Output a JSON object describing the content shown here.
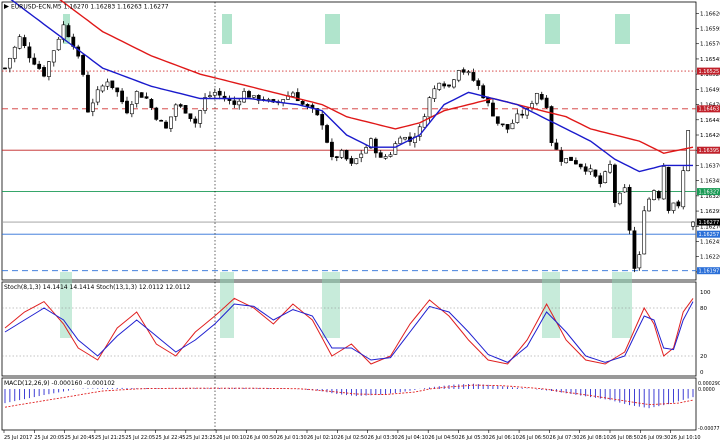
{
  "header": {
    "symbol_line": "EURUSD-ECN,M5  1.16270 1.16283 1.16263 1.16277"
  },
  "price_axis": {
    "ticks": [
      "1.16620",
      "1.16595",
      "1.16570",
      "1.16545",
      "1.16520",
      "1.16495",
      "1.16470",
      "1.16445",
      "1.16420",
      "1.16395",
      "1.16370",
      "1.16345",
      "1.16320",
      "1.16295",
      "1.16270",
      "1.16245",
      "1.16220",
      "1.16195"
    ],
    "range": [
      1.16185,
      1.16632
    ]
  },
  "price_tags": [
    {
      "id": "tag-1",
      "text": "1.16525",
      "price": 1.16525,
      "color": "#c0202a"
    },
    {
      "id": "tag-2",
      "text": "1.16463",
      "price": 1.16463,
      "color": "#c0202a"
    },
    {
      "id": "tag-3",
      "text": "1.16395",
      "price": 1.16395,
      "color": "#c0202a"
    },
    {
      "id": "tag-4",
      "text": "1.16327",
      "price": 1.16327,
      "color": "#1a9a55"
    },
    {
      "id": "tag-5",
      "text": "1.16277",
      "price": 1.16277,
      "color": "#000000"
    },
    {
      "id": "tag-6",
      "text": "1.16257",
      "price": 1.16257,
      "color": "#2a6fd8"
    },
    {
      "id": "tag-7",
      "text": "1.16197",
      "price": 1.16197,
      "color": "#2a6fd8"
    }
  ],
  "hlines": [
    {
      "price": 1.16525,
      "color": "#d03030",
      "style": "dotted"
    },
    {
      "price": 1.16463,
      "color": "#d03030",
      "style": "dashed"
    },
    {
      "price": 1.16395,
      "color": "#c02020",
      "style": "solid"
    },
    {
      "price": 1.16327,
      "color": "#1a9a55",
      "style": "solid"
    },
    {
      "price": 1.16277,
      "color": "#9a9a9a",
      "style": "solid"
    },
    {
      "price": 1.16257,
      "color": "#2a6fd8",
      "style": "solid"
    },
    {
      "price": 1.16197,
      "color": "#2a6fd8",
      "style": "dashed"
    }
  ],
  "stoch": {
    "header": "Stoch(8,1,3) 14.1414 14.1414  Stoch(13,1,3) 12.0112 12.0112",
    "ticks": [
      "100",
      "80",
      "20",
      "0"
    ],
    "range": [
      0,
      100
    ]
  },
  "macd": {
    "header": "MACD(12,26,9) -0.000160 -0.000102",
    "ticks": [
      "0.000290",
      "0.0000",
      "-0.000773"
    ]
  },
  "time_axis": {
    "labels": [
      "25 Jul 2017",
      "25 Jul 20:05",
      "25 Jul 20:45",
      "25 Jul 21:25",
      "25 Jul 22:05",
      "25 Jul 22:45",
      "25 Jul 23:25",
      "26 Jul 00:10",
      "26 Jul 00:50",
      "26 Jul 01:30",
      "26 Jul 02:10",
      "26 Jul 02:50",
      "26 Jul 03:30",
      "26 Jul 04:10",
      "26 Jul 04:50",
      "26 Jul 05:30",
      "26 Jul 06:10",
      "26 Jul 06:50",
      "26 Jul 07:30",
      "26 Jul 08:10",
      "26 Jul 08:50",
      "26 Jul 09:30",
      "26 Jul 10:10"
    ]
  },
  "colors": {
    "bull": "#ffffff",
    "bear": "#000000",
    "ma_fast": "#1a1acc",
    "ma_slow": "#e01818",
    "stoch_main": "#e02020",
    "stoch_signal": "#2020d0",
    "macd_hist": "#2a2ad0",
    "macd_signal": "#e02020",
    "highlight": "#8fd8b6"
  },
  "chart_data": {
    "type": "candlestick",
    "symbol": "EURUSD-ECN",
    "timeframe": "M5",
    "ohlc_last": {
      "open": 1.1627,
      "high": 1.16283,
      "low": 1.16263,
      "close": 1.16277
    },
    "close_path": [
      [
        0,
        1.1653
      ],
      [
        3,
        1.1658
      ],
      [
        5,
        1.1655
      ],
      [
        8,
        1.1652
      ],
      [
        10,
        1.1656
      ],
      [
        12,
        1.166
      ],
      [
        14,
        1.1657
      ],
      [
        16,
        1.1652
      ],
      [
        17,
        1.1646
      ],
      [
        19,
        1.1649
      ],
      [
        21,
        1.1651
      ],
      [
        23,
        1.1649
      ],
      [
        25,
        1.1646
      ],
      [
        27,
        1.1649
      ],
      [
        29,
        1.1648
      ],
      [
        31,
        1.1645
      ],
      [
        33,
        1.1643
      ],
      [
        35,
        1.1647
      ],
      [
        37,
        1.1646
      ],
      [
        39,
        1.1644
      ],
      [
        41,
        1.1648
      ],
      [
        43,
        1.1649
      ],
      [
        45,
        1.1648
      ],
      [
        47,
        1.1647
      ],
      [
        49,
        1.1649
      ],
      [
        51,
        1.1648
      ],
      [
        53,
        1.1648
      ],
      [
        55,
        1.1647
      ],
      [
        57,
        1.1648
      ],
      [
        59,
        1.1649
      ],
      [
        61,
        1.1647
      ],
      [
        63,
        1.1646
      ],
      [
        65,
        1.1644
      ],
      [
        66,
        1.1641
      ],
      [
        67,
        1.1638
      ],
      [
        69,
        1.1639
      ],
      [
        71,
        1.1637
      ],
      [
        73,
        1.1639
      ],
      [
        75,
        1.1641
      ],
      [
        77,
        1.1638
      ],
      [
        79,
        1.1639
      ],
      [
        81,
        1.1642
      ],
      [
        83,
        1.1641
      ],
      [
        85,
        1.1643
      ],
      [
        87,
        1.1648
      ],
      [
        89,
        1.1651
      ],
      [
        91,
        1.165
      ],
      [
        93,
        1.1653
      ],
      [
        95,
        1.1652
      ],
      [
        97,
        1.165
      ],
      [
        99,
        1.1647
      ],
      [
        101,
        1.1644
      ],
      [
        103,
        1.1643
      ],
      [
        105,
        1.1645
      ],
      [
        107,
        1.1646
      ],
      [
        109,
        1.1649
      ],
      [
        111,
        1.1647
      ],
      [
        112,
        1.1641
      ],
      [
        114,
        1.1638
      ],
      [
        116,
        1.1638
      ],
      [
        118,
        1.1637
      ],
      [
        120,
        1.1636
      ],
      [
        122,
        1.1634
      ],
      [
        124,
        1.1637
      ],
      [
        125,
        1.1631
      ],
      [
        127,
        1.1633
      ],
      [
        129,
        1.162
      ],
      [
        130,
        1.1622
      ],
      [
        131,
        1.163
      ],
      [
        133,
        1.1633
      ],
      [
        134,
        1.1632
      ],
      [
        135,
        1.1637
      ],
      [
        136,
        1.163
      ],
      [
        137,
        1.1631
      ],
      [
        138,
        1.163
      ],
      [
        139,
        1.1636
      ],
      [
        140,
        1.1643
      ],
      [
        141,
        1.164
      ]
    ],
    "ma_fast": [
      [
        0,
        1.1665
      ],
      [
        10,
        1.1659
      ],
      [
        20,
        1.1653
      ],
      [
        30,
        1.165
      ],
      [
        40,
        1.1648
      ],
      [
        50,
        1.1648
      ],
      [
        60,
        1.1647
      ],
      [
        65,
        1.1646
      ],
      [
        70,
        1.1642
      ],
      [
        75,
        1.164
      ],
      [
        80,
        1.164
      ],
      [
        85,
        1.1642
      ],
      [
        90,
        1.1647
      ],
      [
        95,
        1.1649
      ],
      [
        100,
        1.1648
      ],
      [
        105,
        1.1647
      ],
      [
        110,
        1.1645
      ],
      [
        115,
        1.1643
      ],
      [
        120,
        1.1641
      ],
      [
        125,
        1.1638
      ],
      [
        130,
        1.1636
      ],
      [
        135,
        1.1637
      ],
      [
        141,
        1.1637
      ]
    ],
    "ma_slow": [
      [
        0,
        1.167
      ],
      [
        10,
        1.1665
      ],
      [
        20,
        1.1659
      ],
      [
        30,
        1.1655
      ],
      [
        40,
        1.1652
      ],
      [
        50,
        1.165
      ],
      [
        60,
        1.1648
      ],
      [
        65,
        1.1647
      ],
      [
        70,
        1.1645
      ],
      [
        75,
        1.1644
      ],
      [
        80,
        1.1643
      ],
      [
        85,
        1.1644
      ],
      [
        90,
        1.1646
      ],
      [
        95,
        1.1647
      ],
      [
        100,
        1.1648
      ],
      [
        105,
        1.1647
      ],
      [
        110,
        1.1646
      ],
      [
        115,
        1.1645
      ],
      [
        120,
        1.1643
      ],
      [
        125,
        1.1642
      ],
      [
        130,
        1.1641
      ],
      [
        135,
        1.1639
      ],
      [
        141,
        1.164
      ]
    ],
    "stoch_main": [
      [
        0,
        55
      ],
      [
        4,
        75
      ],
      [
        8,
        88
      ],
      [
        12,
        60
      ],
      [
        15,
        30
      ],
      [
        19,
        15
      ],
      [
        23,
        55
      ],
      [
        27,
        75
      ],
      [
        31,
        35
      ],
      [
        35,
        20
      ],
      [
        39,
        50
      ],
      [
        43,
        70
      ],
      [
        47,
        92
      ],
      [
        51,
        80
      ],
      [
        55,
        60
      ],
      [
        59,
        85
      ],
      [
        63,
        65
      ],
      [
        67,
        20
      ],
      [
        71,
        35
      ],
      [
        75,
        10
      ],
      [
        79,
        20
      ],
      [
        83,
        60
      ],
      [
        87,
        90
      ],
      [
        91,
        70
      ],
      [
        95,
        40
      ],
      [
        99,
        15
      ],
      [
        103,
        10
      ],
      [
        107,
        40
      ],
      [
        111,
        85
      ],
      [
        115,
        40
      ],
      [
        119,
        15
      ],
      [
        123,
        10
      ],
      [
        127,
        25
      ],
      [
        131,
        80
      ],
      [
        133,
        60
      ],
      [
        135,
        20
      ],
      [
        137,
        30
      ],
      [
        139,
        75
      ],
      [
        141,
        92
      ]
    ],
    "stoch_signal": [
      [
        0,
        50
      ],
      [
        4,
        65
      ],
      [
        8,
        80
      ],
      [
        12,
        65
      ],
      [
        15,
        40
      ],
      [
        19,
        20
      ],
      [
        23,
        45
      ],
      [
        27,
        65
      ],
      [
        31,
        45
      ],
      [
        35,
        25
      ],
      [
        39,
        40
      ],
      [
        43,
        60
      ],
      [
        47,
        85
      ],
      [
        51,
        82
      ],
      [
        55,
        65
      ],
      [
        59,
        78
      ],
      [
        63,
        70
      ],
      [
        67,
        30
      ],
      [
        71,
        30
      ],
      [
        75,
        15
      ],
      [
        79,
        18
      ],
      [
        83,
        50
      ],
      [
        87,
        82
      ],
      [
        91,
        75
      ],
      [
        95,
        50
      ],
      [
        99,
        22
      ],
      [
        103,
        12
      ],
      [
        107,
        32
      ],
      [
        111,
        75
      ],
      [
        115,
        50
      ],
      [
        119,
        20
      ],
      [
        123,
        12
      ],
      [
        127,
        20
      ],
      [
        131,
        70
      ],
      [
        133,
        65
      ],
      [
        135,
        30
      ],
      [
        137,
        28
      ],
      [
        139,
        65
      ],
      [
        141,
        88
      ]
    ],
    "macd_hist": [
      [
        0,
        -0.00028
      ],
      [
        8,
        -0.00012
      ],
      [
        16,
        2e-05
      ],
      [
        24,
        4e-05
      ],
      [
        32,
        2e-05
      ],
      [
        40,
        3e-05
      ],
      [
        48,
        4e-05
      ],
      [
        56,
        2e-05
      ],
      [
        64,
        -3e-05
      ],
      [
        68,
        -0.0001
      ],
      [
        72,
        -0.00014
      ],
      [
        76,
        -0.00012
      ],
      [
        80,
        -8e-05
      ],
      [
        84,
        -2e-05
      ],
      [
        88,
        8e-05
      ],
      [
        92,
        0.00016
      ],
      [
        96,
        0.00019
      ],
      [
        100,
        0.00014
      ],
      [
        104,
        6e-05
      ],
      [
        108,
        0.0
      ],
      [
        112,
        -4e-05
      ],
      [
        116,
        -0.0001
      ],
      [
        120,
        -0.00016
      ],
      [
        124,
        -0.00022
      ],
      [
        128,
        -0.00032
      ],
      [
        132,
        -0.00038
      ],
      [
        136,
        -0.0003
      ],
      [
        141,
        -0.00016
      ]
    ],
    "macd_signal": [
      [
        0,
        -0.00036
      ],
      [
        10,
        -0.0002
      ],
      [
        20,
        -4e-05
      ],
      [
        30,
        2e-05
      ],
      [
        40,
        3e-05
      ],
      [
        50,
        3e-05
      ],
      [
        60,
        1e-05
      ],
      [
        66,
        -4e-05
      ],
      [
        72,
        -0.0001
      ],
      [
        78,
        -0.00011
      ],
      [
        84,
        -6e-05
      ],
      [
        90,
        6e-05
      ],
      [
        96,
        0.00014
      ],
      [
        102,
        0.00012
      ],
      [
        108,
        4e-05
      ],
      [
        114,
        -5e-05
      ],
      [
        120,
        -0.00013
      ],
      [
        126,
        -0.00022
      ],
      [
        132,
        -0.00031
      ],
      [
        138,
        -0.00028
      ],
      [
        141,
        -0.00022
      ]
    ]
  }
}
